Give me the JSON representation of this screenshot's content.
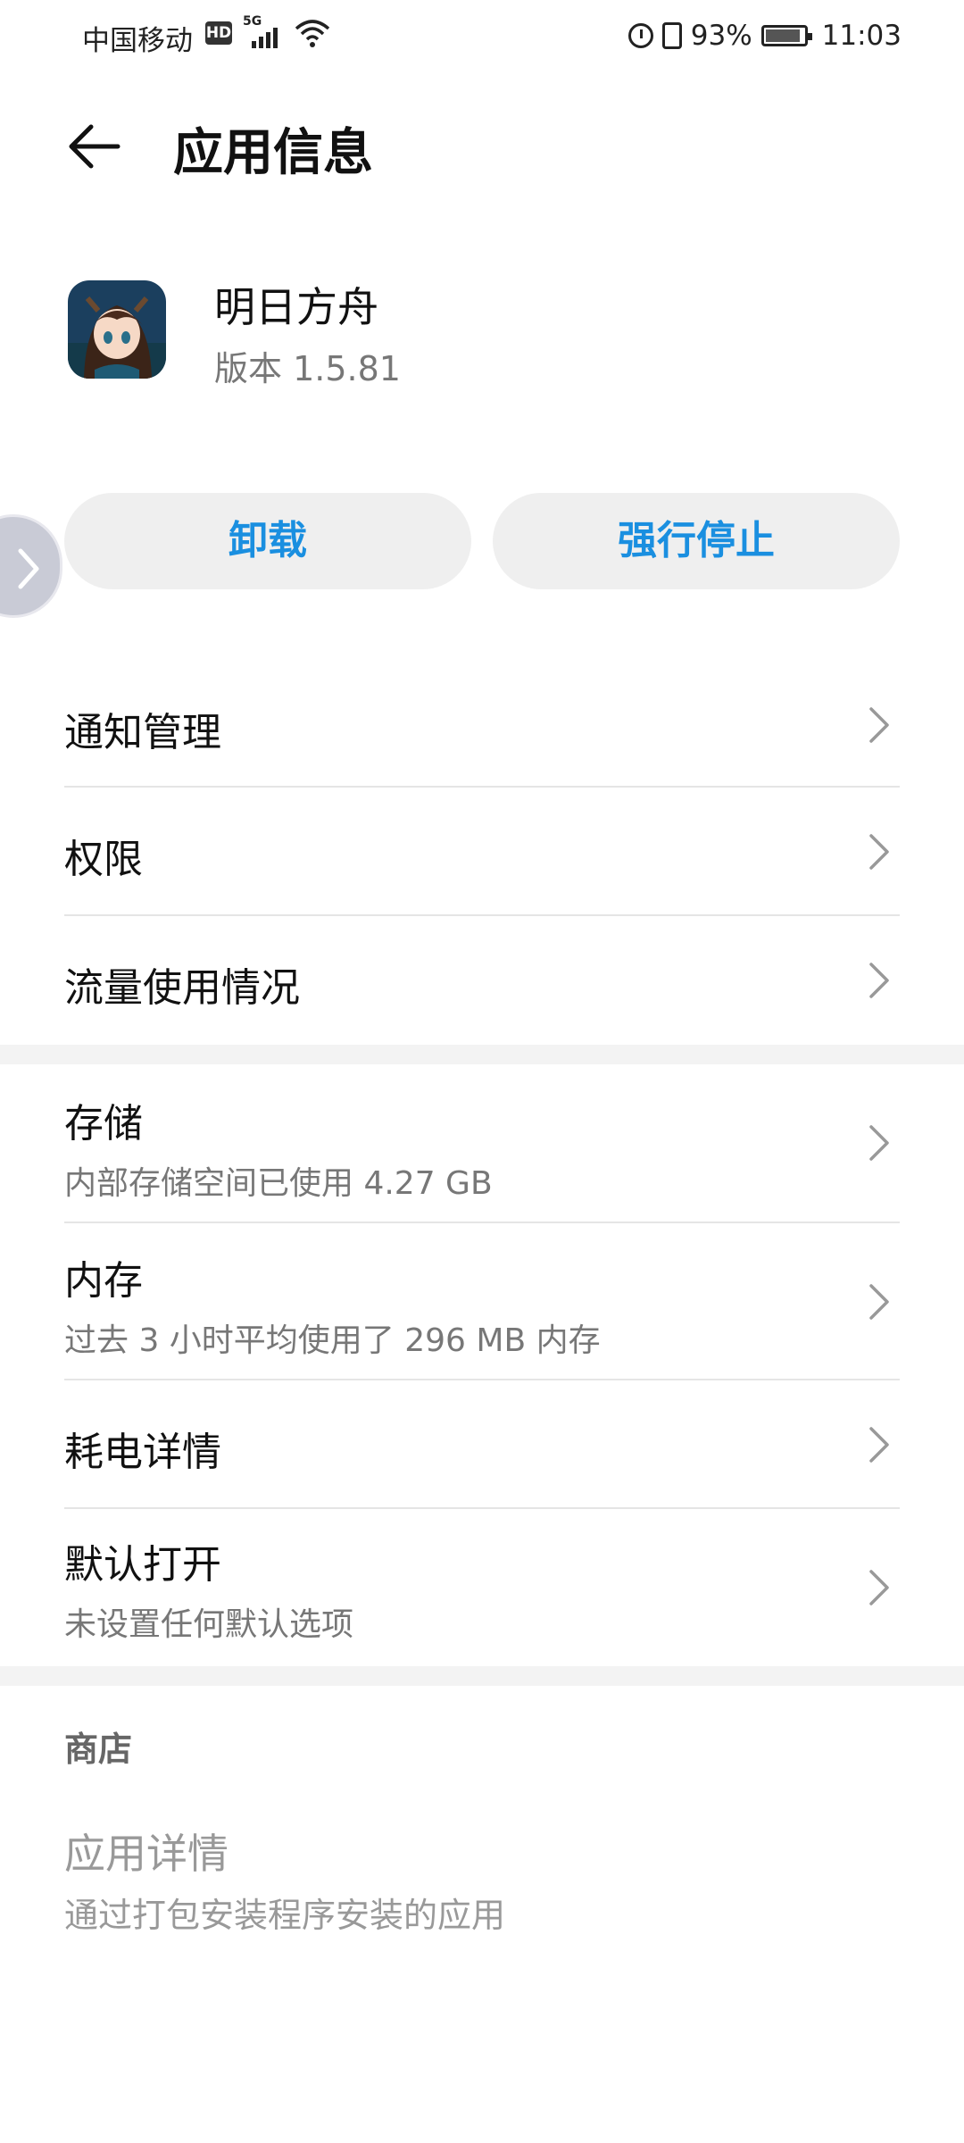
{
  "status_bar": {
    "carrier": "中国移动",
    "hd_badge": "HD",
    "network": "5G",
    "battery_pct": "93%",
    "time": "11:03",
    "icons": [
      "signal-icon",
      "wifi-icon",
      "alarm-icon",
      "vibrate-icon",
      "battery-charging-icon"
    ]
  },
  "header": {
    "title": "应用信息",
    "back_icon": "arrow-left-icon"
  },
  "app": {
    "name": "明日方舟",
    "version": "版本 1.5.81"
  },
  "buttons": {
    "uninstall": "卸载",
    "force_stop": "强行停止",
    "accent": "#1a8fe0"
  },
  "menu": {
    "notification": "通知管理",
    "permissions": "权限",
    "data_usage": "流量使用情况",
    "storage": {
      "label": "存储",
      "sub": "内部存储空间已使用 4.27 GB"
    },
    "memory": {
      "label": "内存",
      "sub": "过去 3 小时平均使用了 296 MB 内存"
    },
    "battery": "耗电详情",
    "open_default": {
      "label": "默认打开",
      "sub": "未设置任何默认选项"
    }
  },
  "store": {
    "header": "商店",
    "details_label": "应用详情",
    "details_sub": "通过打包安装程序安装的应用"
  }
}
